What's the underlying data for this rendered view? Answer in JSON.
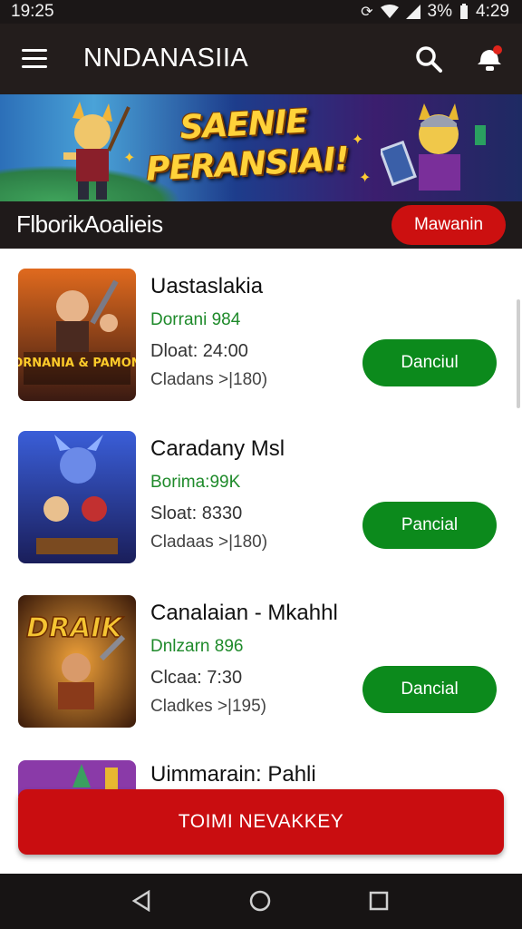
{
  "status_bar": {
    "time": "19:25",
    "battery": "3%",
    "clock": "4:29"
  },
  "app_bar": {
    "title": "NNDANASIIA"
  },
  "banner": {
    "line1": "SAENIE",
    "line2": "PERANSIAI!"
  },
  "section": {
    "title": "FlborikAoalieis",
    "action_label": "Mawanin"
  },
  "games": [
    {
      "name": "Uastaslakia",
      "stat": "Dorrani 984",
      "time": "Dloat: 24:00",
      "class": "Cladans   >|180)",
      "button": "Danciul",
      "thumb_text": "BORNANIA & PAMONA"
    },
    {
      "name": "Caradany Msl",
      "stat": "Borima:99K",
      "time": "Sloat: 8330",
      "class": "Cladaas   >|180)",
      "button": "Pancial",
      "thumb_text": ""
    },
    {
      "name": "Canalaian - Mkahhl",
      "stat": "Dnlzarn 896",
      "time": "Clcaa: 7:30",
      "class": "Cladkes   >|195)",
      "button": "Dancial",
      "thumb_text": "DRAIK"
    },
    {
      "name": "Uimmarain: Pahli",
      "stat": "",
      "time": "",
      "class": "",
      "button": "",
      "thumb_text": ""
    }
  ],
  "cta": {
    "label": "TOIMI NEVAKKEY"
  },
  "colors": {
    "accent_red": "#cc1010",
    "action_green": "#0c8a1c",
    "stat_green": "#1e8a2a",
    "appbar_bg": "#231d1c"
  },
  "icons": {
    "menu": "hamburger-icon",
    "search": "search-icon",
    "notification": "notification-icon",
    "back": "back-triangle-icon",
    "home": "home-circle-icon",
    "recents": "recents-square-icon"
  }
}
